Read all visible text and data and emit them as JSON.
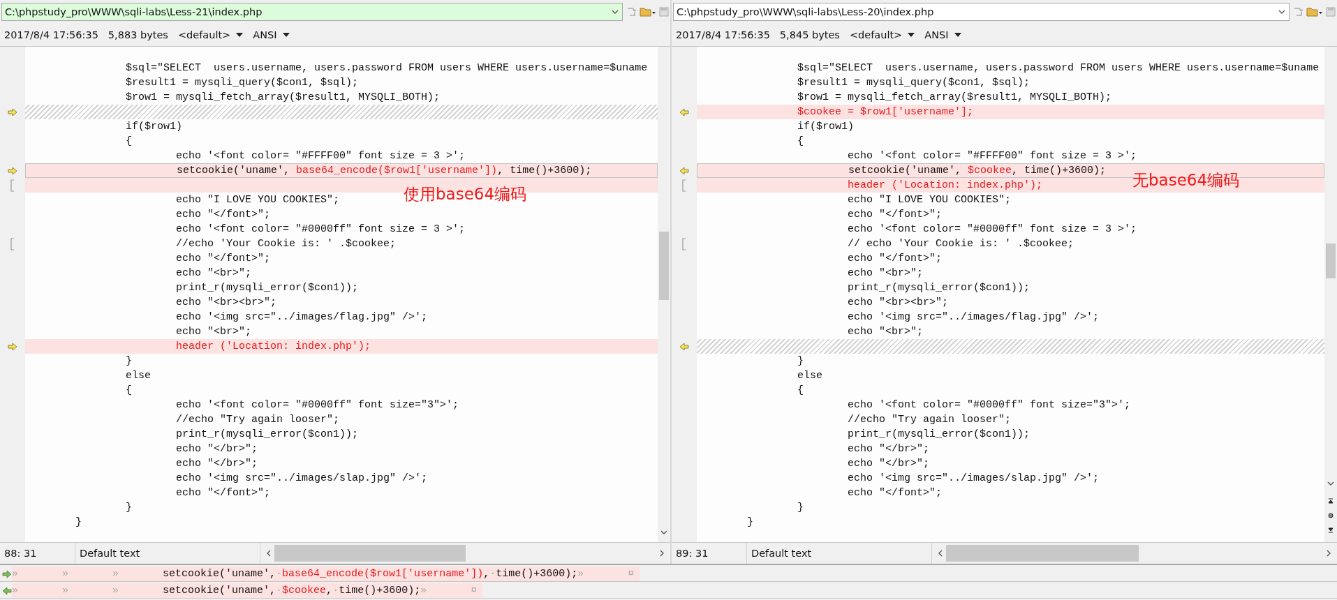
{
  "panes": [
    {
      "kind": "left-file",
      "path": "C:\\phpstudy_pro\\WWW\\sqli-labs\\Less-21\\index.php",
      "highlighted": true,
      "date": "2017/8/4 17:56:35",
      "size": "5,883 bytes",
      "syntax": "<default>",
      "encoding": "ANSI",
      "annotation": "使用base64编码",
      "position": "88: 31",
      "mode": "Default text",
      "lines": [
        {
          "kind": "same",
          "arrow": false,
          "bracket": false,
          "text": "\t\t$sql=\"SELECT  users.username, users.password FROM users WHERE users.username=$uname"
        },
        {
          "kind": "same",
          "arrow": false,
          "bracket": false,
          "text": "\t\t$result1 = mysqli_query($con1, $sql);"
        },
        {
          "kind": "same",
          "arrow": false,
          "bracket": false,
          "text": "\t\t$row1 = mysqli_fetch_array($result1, MYSQLI_BOTH);"
        },
        {
          "kind": "gap",
          "arrow": true,
          "bracket": false
        },
        {
          "kind": "same",
          "arrow": false,
          "bracket": false,
          "text": "\t\tif($row1)"
        },
        {
          "kind": "same",
          "arrow": false,
          "bracket": false,
          "text": "\t\t{"
        },
        {
          "kind": "same",
          "arrow": false,
          "bracket": false,
          "text": "\t\t\techo '<font color= \"#FFFF00\" font size = 3 >';"
        },
        {
          "kind": "changed",
          "arrow": true,
          "bracket": false,
          "parts": [
            {
              "text": "\t\t\tsetcookie('uname', ",
              "changed": false
            },
            {
              "text": "base64_encode($row1['username'])",
              "changed": true
            },
            {
              "text": ", time()+3600);",
              "changed": false
            }
          ]
        },
        {
          "kind": "added",
          "arrow": false,
          "bracket": true
        },
        {
          "kind": "same",
          "arrow": false,
          "bracket": false,
          "text": "\t\t\techo \"I LOVE YOU COOKIES\";"
        },
        {
          "kind": "same",
          "arrow": false,
          "bracket": false,
          "text": "\t\t\techo \"</font>\";"
        },
        {
          "kind": "same",
          "arrow": false,
          "bracket": false,
          "text": "\t\t\techo '<font color= \"#0000ff\" font size = 3 >';"
        },
        {
          "kind": "same",
          "arrow": false,
          "bracket": true,
          "text": "\t\t\t//echo 'Your Cookie is: ' .$cookee;"
        },
        {
          "kind": "same",
          "arrow": false,
          "bracket": false,
          "text": "\t\t\techo \"</font>\";"
        },
        {
          "kind": "same",
          "arrow": false,
          "bracket": false,
          "text": "\t\t\techo \"<br>\";"
        },
        {
          "kind": "same",
          "arrow": false,
          "bracket": false,
          "text": "\t\t\tprint_r(mysqli_error($con1));"
        },
        {
          "kind": "same",
          "arrow": false,
          "bracket": false,
          "text": "\t\t\techo \"<br><br>\";"
        },
        {
          "kind": "same",
          "arrow": false,
          "bracket": false,
          "text": "\t\t\techo '<img src=\"../images/flag.jpg\" />';"
        },
        {
          "kind": "same",
          "arrow": false,
          "bracket": false,
          "text": "\t\t\techo \"<br>\";"
        },
        {
          "kind": "added",
          "arrow": true,
          "bracket": false,
          "text": "\t\t\theader ('Location: index.php');"
        },
        {
          "kind": "same",
          "arrow": false,
          "bracket": false,
          "text": "\t\t}"
        },
        {
          "kind": "same",
          "arrow": false,
          "bracket": false,
          "text": "\t\telse"
        },
        {
          "kind": "same",
          "arrow": false,
          "bracket": false,
          "text": "\t\t{"
        },
        {
          "kind": "same",
          "arrow": false,
          "bracket": false,
          "text": "\t\t\techo '<font color= \"#0000ff\" font size=\"3\">';"
        },
        {
          "kind": "same",
          "arrow": false,
          "bracket": false,
          "text": "\t\t\t//echo \"Try again looser\";"
        },
        {
          "kind": "same",
          "arrow": false,
          "bracket": false,
          "text": "\t\t\tprint_r(mysqli_error($con1));"
        },
        {
          "kind": "same",
          "arrow": false,
          "bracket": false,
          "text": "\t\t\techo \"</br>\";"
        },
        {
          "kind": "same",
          "arrow": false,
          "bracket": false,
          "text": "\t\t\techo \"</br>\";"
        },
        {
          "kind": "same",
          "arrow": false,
          "bracket": false,
          "text": "\t\t\techo '<img src=\"../images/slap.jpg\" />';"
        },
        {
          "kind": "same",
          "arrow": false,
          "bracket": false,
          "text": "\t\t\techo \"</font>\";"
        },
        {
          "kind": "same",
          "arrow": false,
          "bracket": false,
          "text": "\t\t}"
        },
        {
          "kind": "same",
          "arrow": false,
          "bracket": false,
          "text": "\t}"
        }
      ]
    },
    {
      "kind": "right-file",
      "path": "C:\\phpstudy_pro\\WWW\\sqli-labs\\Less-20\\index.php",
      "highlighted": false,
      "date": "2017/8/4 17:56:35",
      "size": "5,845 bytes",
      "syntax": "<default>",
      "encoding": "ANSI",
      "annotation": "无base64编码",
      "position": "89: 31",
      "mode": "Default text",
      "lines": [
        {
          "kind": "same",
          "arrow": false,
          "bracket": false,
          "text": "\t\t$sql=\"SELECT  users.username, users.password FROM users WHERE users.username=$uname"
        },
        {
          "kind": "same",
          "arrow": false,
          "bracket": false,
          "text": "\t\t$result1 = mysqli_query($con1, $sql);"
        },
        {
          "kind": "same",
          "arrow": false,
          "bracket": false,
          "text": "\t\t$row1 = mysqli_fetch_array($result1, MYSQLI_BOTH);"
        },
        {
          "kind": "added",
          "arrow": true,
          "bracket": false,
          "text": "\t\t$cookee = $row1['username'];"
        },
        {
          "kind": "same",
          "arrow": false,
          "bracket": false,
          "text": "\t\tif($row1)"
        },
        {
          "kind": "same",
          "arrow": false,
          "bracket": false,
          "text": "\t\t{"
        },
        {
          "kind": "same",
          "arrow": false,
          "bracket": false,
          "text": "\t\t\techo '<font color= \"#FFFF00\" font size = 3 >';"
        },
        {
          "kind": "changed",
          "arrow": true,
          "bracket": false,
          "parts": [
            {
              "text": "\t\t\tsetcookie('uname', ",
              "changed": false
            },
            {
              "text": "$cookee",
              "changed": true
            },
            {
              "text": ", time()+3600);",
              "changed": false
            }
          ]
        },
        {
          "kind": "added",
          "arrow": false,
          "bracket": true,
          "text": "\t\t\theader ('Location: index.php');"
        },
        {
          "kind": "same",
          "arrow": false,
          "bracket": false,
          "text": "\t\t\techo \"I LOVE YOU COOKIES\";"
        },
        {
          "kind": "same",
          "arrow": false,
          "bracket": false,
          "text": "\t\t\techo \"</font>\";"
        },
        {
          "kind": "same",
          "arrow": false,
          "bracket": false,
          "text": "\t\t\techo '<font color= \"#0000ff\" font size = 3 >';"
        },
        {
          "kind": "same",
          "arrow": false,
          "bracket": true,
          "text": "\t\t\t// echo 'Your Cookie is: ' .$cookee;"
        },
        {
          "kind": "same",
          "arrow": false,
          "bracket": false,
          "text": "\t\t\techo \"</font>\";"
        },
        {
          "kind": "same",
          "arrow": false,
          "bracket": false,
          "text": "\t\t\techo \"<br>\";"
        },
        {
          "kind": "same",
          "arrow": false,
          "bracket": false,
          "text": "\t\t\tprint_r(mysqli_error($con1));"
        },
        {
          "kind": "same",
          "arrow": false,
          "bracket": false,
          "text": "\t\t\techo \"<br><br>\";"
        },
        {
          "kind": "same",
          "arrow": false,
          "bracket": false,
          "text": "\t\t\techo '<img src=\"../images/flag.jpg\" />';"
        },
        {
          "kind": "same",
          "arrow": false,
          "bracket": false,
          "text": "\t\t\techo \"<br>\";"
        },
        {
          "kind": "gap",
          "arrow": true,
          "bracket": false
        },
        {
          "kind": "same",
          "arrow": false,
          "bracket": false,
          "text": "\t\t}"
        },
        {
          "kind": "same",
          "arrow": false,
          "bracket": false,
          "text": "\t\telse"
        },
        {
          "kind": "same",
          "arrow": false,
          "bracket": false,
          "text": "\t\t{"
        },
        {
          "kind": "same",
          "arrow": false,
          "bracket": false,
          "text": "\t\t\techo '<font color= \"#0000ff\" font size=\"3\">';"
        },
        {
          "kind": "same",
          "arrow": false,
          "bracket": false,
          "text": "\t\t\t//echo \"Try again looser\";"
        },
        {
          "kind": "same",
          "arrow": false,
          "bracket": false,
          "text": "\t\t\tprint_r(mysqli_error($con1));"
        },
        {
          "kind": "same",
          "arrow": false,
          "bracket": false,
          "text": "\t\t\techo \"</br>\";"
        },
        {
          "kind": "same",
          "arrow": false,
          "bracket": false,
          "text": "\t\t\techo \"</br>\";"
        },
        {
          "kind": "same",
          "arrow": false,
          "bracket": false,
          "text": "\t\t\techo '<img src=\"../images/slap.jpg\" />';"
        },
        {
          "kind": "same",
          "arrow": false,
          "bracket": false,
          "text": "\t\t\techo \"</font>\";"
        },
        {
          "kind": "same",
          "arrow": false,
          "bracket": false,
          "text": "\t\t}"
        },
        {
          "kind": "same",
          "arrow": false,
          "bracket": false,
          "text": "\t}"
        }
      ]
    }
  ],
  "compare": [
    {
      "kind": "left-file",
      "parts": [
        {
          "kind": "ws",
          "text": "»\t»\t»\t"
        },
        {
          "kind": "code",
          "text": "setcookie('uname',"
        },
        {
          "kind": "ws",
          "text": "·"
        },
        {
          "kind": "changed",
          "text": "base64_encode($row1['username'])"
        },
        {
          "kind": "code",
          "text": ","
        },
        {
          "kind": "ws",
          "text": "·"
        },
        {
          "kind": "code",
          "text": "time()+3600);"
        },
        {
          "kind": "ws",
          "text": "»\t¤"
        }
      ]
    },
    {
      "kind": "right-file",
      "parts": [
        {
          "kind": "ws",
          "text": "»\t»\t»\t"
        },
        {
          "kind": "code",
          "text": "setcookie('uname',"
        },
        {
          "kind": "ws",
          "text": "·"
        },
        {
          "kind": "changed",
          "text": "$cookee"
        },
        {
          "kind": "code",
          "text": ","
        },
        {
          "kind": "ws",
          "text": "·"
        },
        {
          "kind": "code",
          "text": "time()+3600);"
        },
        {
          "kind": "ws",
          "text": "»\t¤"
        }
      ]
    }
  ]
}
